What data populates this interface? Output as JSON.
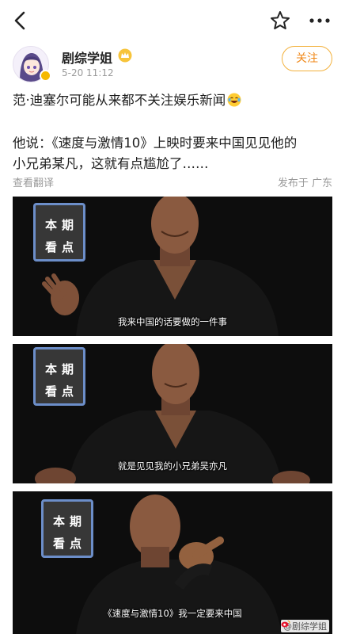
{
  "author": {
    "name": "剧综学姐",
    "time": "5-20 11:12",
    "follow_label": "关注"
  },
  "post": {
    "line1": "范·迪塞尔可能从来都不关注娱乐新闻",
    "line2": "他说：《速度与激情10》上映时要来中国见见他的",
    "line3": "小兄弟某凡，这就有点尴尬了……",
    "translate_label": "查看翻译",
    "location": "发布于 广东"
  },
  "frames": [
    {
      "badge_top": "本期",
      "badge_bottom": "看点",
      "subtitle": "我来中国的话要做的一件事"
    },
    {
      "badge_top": "本期",
      "badge_bottom": "看点",
      "subtitle": "就是见见我的小兄弟吴亦凡"
    },
    {
      "badge_top": "本期",
      "badge_bottom": "看点",
      "subtitle": "《速度与激情10》我一定要来中国"
    }
  ],
  "watermark": "@剧综学姐",
  "icons": [
    "back-arrow-icon",
    "star-icon",
    "more-icon",
    "vip-crown-icon",
    "laugh-emoji-icon",
    "weibo-logo-icon"
  ],
  "colors": {
    "follow_border": "#f3b13c",
    "follow_text": "#f08a1c",
    "meta_gray": "#9a9a9a",
    "badge_border": "#6c8ec9",
    "frame_bg": "#0d0d0d"
  }
}
